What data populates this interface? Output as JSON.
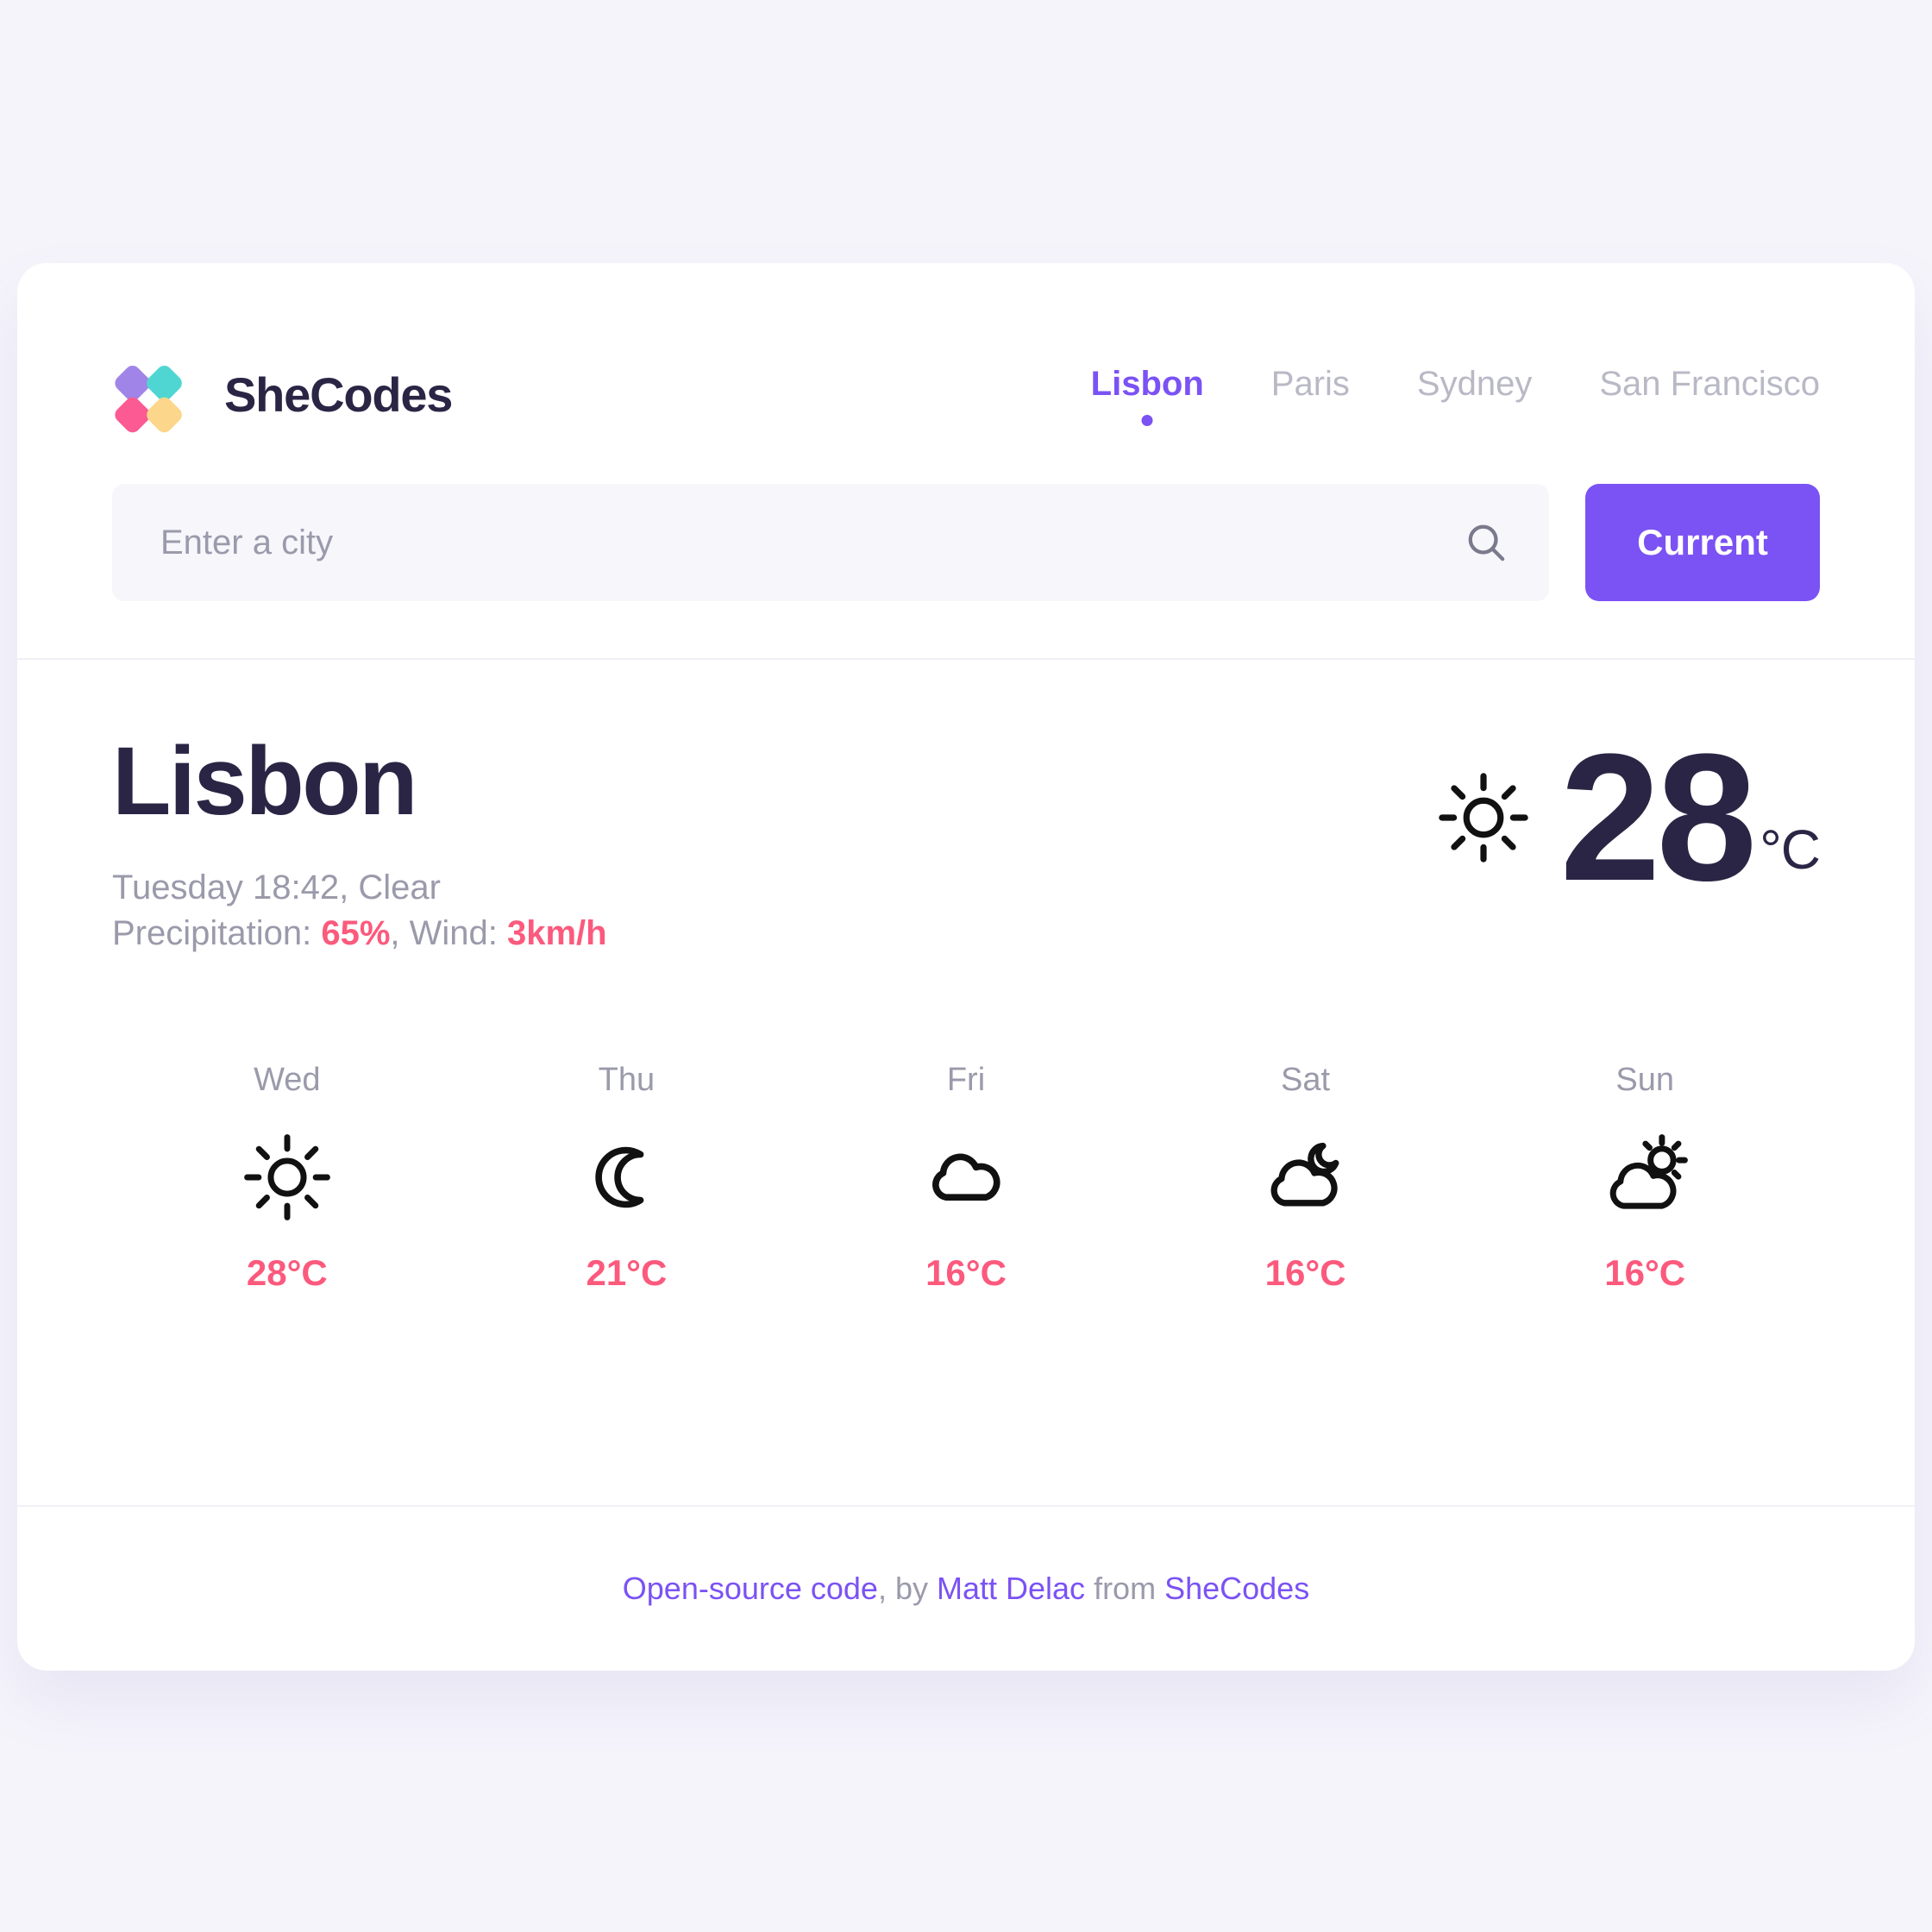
{
  "brand": {
    "name": "SheCodes",
    "logo_colors": {
      "purple": "#a084e8",
      "pink": "#fb5a92",
      "teal": "#4fd6d2",
      "yellow": "#fcd68a"
    }
  },
  "nav": {
    "items": [
      {
        "label": "Lisbon",
        "active": true
      },
      {
        "label": "Paris",
        "active": false
      },
      {
        "label": "Sydney",
        "active": false
      },
      {
        "label": "San Francisco",
        "active": false
      }
    ]
  },
  "search": {
    "placeholder": "Enter a city",
    "value": "",
    "icon": "search-icon",
    "button_label": "Current"
  },
  "current": {
    "city": "Lisbon",
    "day_time": "Tuesday 18:42",
    "condition": "Clear",
    "meta_line": "Tuesday 18:42, Clear",
    "precipitation_label": "Precipitation: ",
    "precipitation_value": "65%",
    "separator": ", ",
    "wind_label": "Wind: ",
    "wind_value": "3km/h",
    "temperature": "28",
    "unit": "°C",
    "icon": "sun-icon"
  },
  "forecast": {
    "days": [
      {
        "label": "Wed",
        "icon": "sun-icon",
        "temp": "28°C"
      },
      {
        "label": "Thu",
        "icon": "moon-icon",
        "temp": "21°C"
      },
      {
        "label": "Fri",
        "icon": "cloud-icon",
        "temp": "16°C"
      },
      {
        "label": "Sat",
        "icon": "cloud-moon-icon",
        "temp": "16°C"
      },
      {
        "label": "Sun",
        "icon": "cloud-sun-icon",
        "temp": "16°C"
      }
    ]
  },
  "footer": {
    "link_source": "Open-source code",
    "by_text": ", by ",
    "author": "Matt Delac",
    "from_text": " from ",
    "org": "SheCodes"
  },
  "colors": {
    "accent_purple": "#7b52f4",
    "accent_pink": "#fb5a7d",
    "text_dark": "#2b2545",
    "text_muted": "#9a9aab",
    "page_bg": "#f5f4fb",
    "card_bg": "#ffffff",
    "input_bg": "#f6f6fb"
  }
}
